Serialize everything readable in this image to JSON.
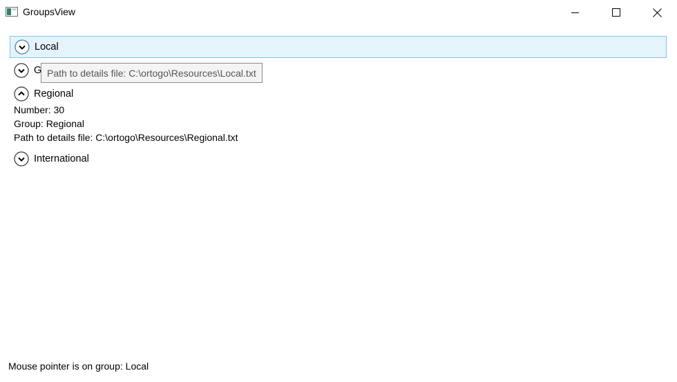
{
  "window": {
    "title": "GroupsView",
    "icon": "app-window-icon",
    "controls": {
      "minimize_icon": "minimize-icon",
      "maximize_icon": "maximize-icon",
      "close_icon": "close-icon"
    }
  },
  "groups": [
    {
      "label": "Local",
      "expanded": false,
      "hovered": true
    },
    {
      "label": "G",
      "expanded": false,
      "hovered": false
    },
    {
      "label": "Regional",
      "expanded": true,
      "hovered": false,
      "details": {
        "number": "Number: 30",
        "group": "Group: Regional",
        "path": "Path to details file: C:\\ortogo\\Resources\\Regional.txt"
      }
    },
    {
      "label": "International",
      "expanded": false,
      "hovered": false
    }
  ],
  "tooltip": {
    "text": "Path to details file: C:\\ortogo\\Resources\\Local.txt"
  },
  "status": {
    "text": "Mouse pointer is on group: Local"
  },
  "colors": {
    "hover_background": "#e5f3fb",
    "hover_border": "#7dc5ea",
    "expander_hover": "#3c7fb1"
  }
}
